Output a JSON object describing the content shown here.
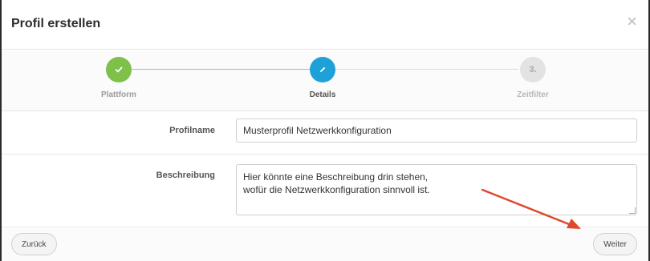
{
  "dialog": {
    "title": "Profil erstellen",
    "close_glyph": "×"
  },
  "stepper": {
    "steps": [
      {
        "label": "Plattform",
        "state": "completed",
        "icon": "check-icon"
      },
      {
        "label": "Details",
        "state": "active",
        "icon": "pencil-icon"
      },
      {
        "label": "Zeitfilter",
        "state": "pending",
        "number": "3."
      }
    ],
    "colors": {
      "completed": "#7dc04a",
      "active": "#1ea0d9",
      "pending": "#e3e3e3"
    }
  },
  "form": {
    "profilname_label": "Profilname",
    "profilname_value": "Musterprofil Netzwerkkonfiguration",
    "beschreibung_label": "Beschreibung",
    "beschreibung_value": "Hier könnte eine Beschreibung drin stehen,\nwofür die Netzwerkkonfiguration sinnvoll ist."
  },
  "footer": {
    "back_label": "Zurück",
    "next_label": "Weiter"
  },
  "annotation": {
    "arrow_color": "#e0482e"
  }
}
